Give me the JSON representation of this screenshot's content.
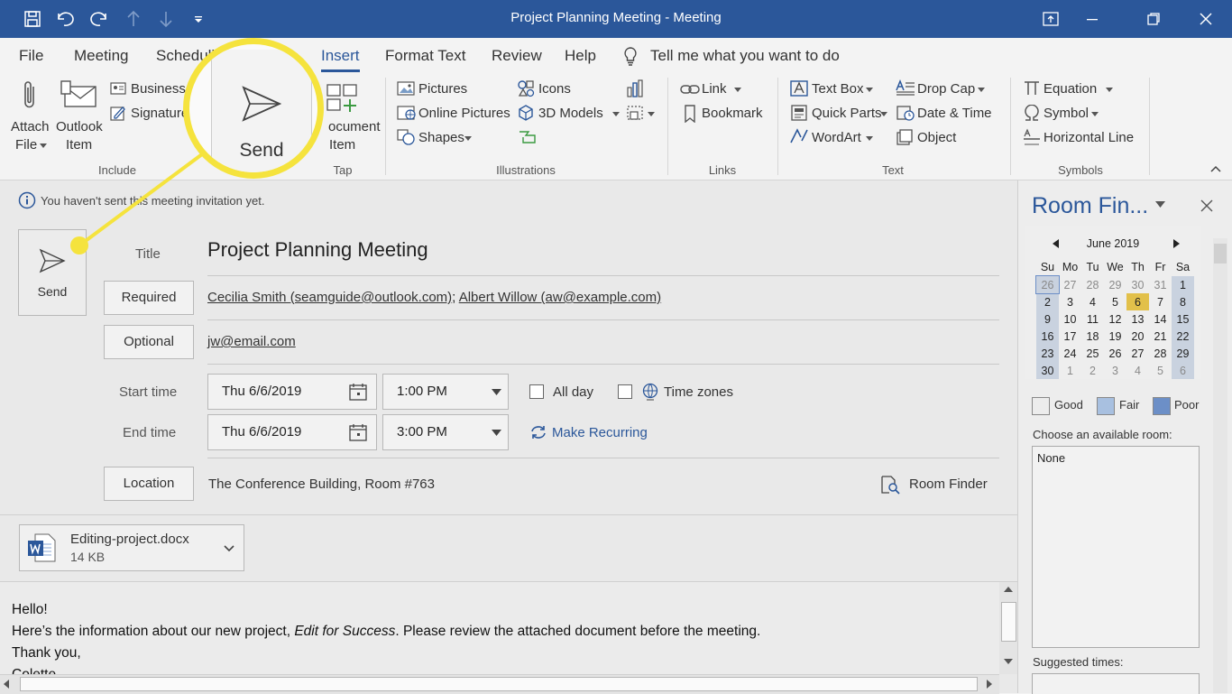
{
  "window": {
    "title": "Project Planning Meeting  -  Meeting"
  },
  "ribbon_tabs": [
    "File",
    "Meeting",
    "Scheduling",
    "Insert",
    "Format Text",
    "Review",
    "Help"
  ],
  "tell_me": "Tell me what you want to do",
  "ribbon": {
    "include": {
      "attach_file_1": "Attach",
      "attach_file_2": "File",
      "outlook_item_1": "Outlook",
      "outlook_item_2": "Item",
      "business_card": "Business",
      "signature": "Signature",
      "label": "Include"
    },
    "tags": {
      "document_item_1": "ocument",
      "document_item_2": "Item",
      "label": "Tap"
    },
    "illustrations": {
      "pictures": "Pictures",
      "online_pictures": "Online Pictures",
      "shapes": "Shapes",
      "icons": "Icons",
      "models": "3D Models",
      "label": "Illustrations"
    },
    "links": {
      "link": "Link",
      "bookmark": "Bookmark",
      "label": "Links"
    },
    "text": {
      "text_box": "Text Box",
      "quick_parts": "Quick Parts",
      "wordart": "WordArt",
      "drop_cap": "Drop Cap",
      "date_time": "Date & Time",
      "object": "Object",
      "label": "Text"
    },
    "symbols": {
      "equation": "Equation",
      "symbol": "Symbol",
      "horizontal_line": "Horizontal Line",
      "label": "Symbols"
    }
  },
  "callout": {
    "send_label": "Send"
  },
  "infobar": "You haven't sent this meeting invitation yet.",
  "form": {
    "send_label": "Send",
    "title_label": "Title",
    "title_value": "Project Planning Meeting",
    "required_label": "Required",
    "required_1": "Cecilia Smith (seamguide@outlook.com)",
    "required_sep": ";",
    "required_2": "Albert Willow (aw@example.com)",
    "optional_label": "Optional",
    "optional_value": "jw@email.com",
    "start_label": "Start time",
    "start_date": "Thu 6/6/2019",
    "start_time": "1:00 PM",
    "all_day": "All day",
    "time_zones": "Time zones",
    "end_label": "End time",
    "end_date": "Thu 6/6/2019",
    "end_time": "3:00 PM",
    "make_recurring": "Make Recurring",
    "location_label": "Location",
    "location_value": "The Conference Building, Room #763",
    "room_finder": "Room Finder"
  },
  "attachment": {
    "name": "Editing-project.docx",
    "size": "14 KB"
  },
  "body": {
    "line1": "Hello!",
    "line2a": "Here’s the information about our new project, ",
    "line2b": "Edit for Success",
    "line2c": ". Please review the attached document before the meeting.",
    "line3": "Thank you,",
    "line4": "Colette"
  },
  "room_finder_pane": {
    "title": "Room Fin...",
    "month": "June 2019",
    "weekdays": [
      "Su",
      "Mo",
      "Tu",
      "We",
      "Th",
      "Fr",
      "Sa"
    ],
    "weeks": [
      [
        "26",
        "27",
        "28",
        "29",
        "30",
        "31",
        "1"
      ],
      [
        "2",
        "3",
        "4",
        "5",
        "6",
        "7",
        "8"
      ],
      [
        "9",
        "10",
        "11",
        "12",
        "13",
        "14",
        "15"
      ],
      [
        "16",
        "17",
        "18",
        "19",
        "20",
        "21",
        "22"
      ],
      [
        "23",
        "24",
        "25",
        "26",
        "27",
        "28",
        "29"
      ],
      [
        "30",
        "1",
        "2",
        "3",
        "4",
        "5",
        "6"
      ]
    ],
    "selected_day": "6",
    "legend": {
      "good": "Good",
      "fair": "Fair",
      "poor": "Poor"
    },
    "colors": {
      "good": "#ffffff",
      "fair": "#a8c0e0",
      "poor": "#6c8fc7",
      "selected": "#e2c04a",
      "weekend": "#c9d2df",
      "accent": "#2b579a",
      "callout": "#f5e33d"
    },
    "choose_room": "Choose an available room:",
    "room_value": "None",
    "suggested": "Suggested times:"
  }
}
